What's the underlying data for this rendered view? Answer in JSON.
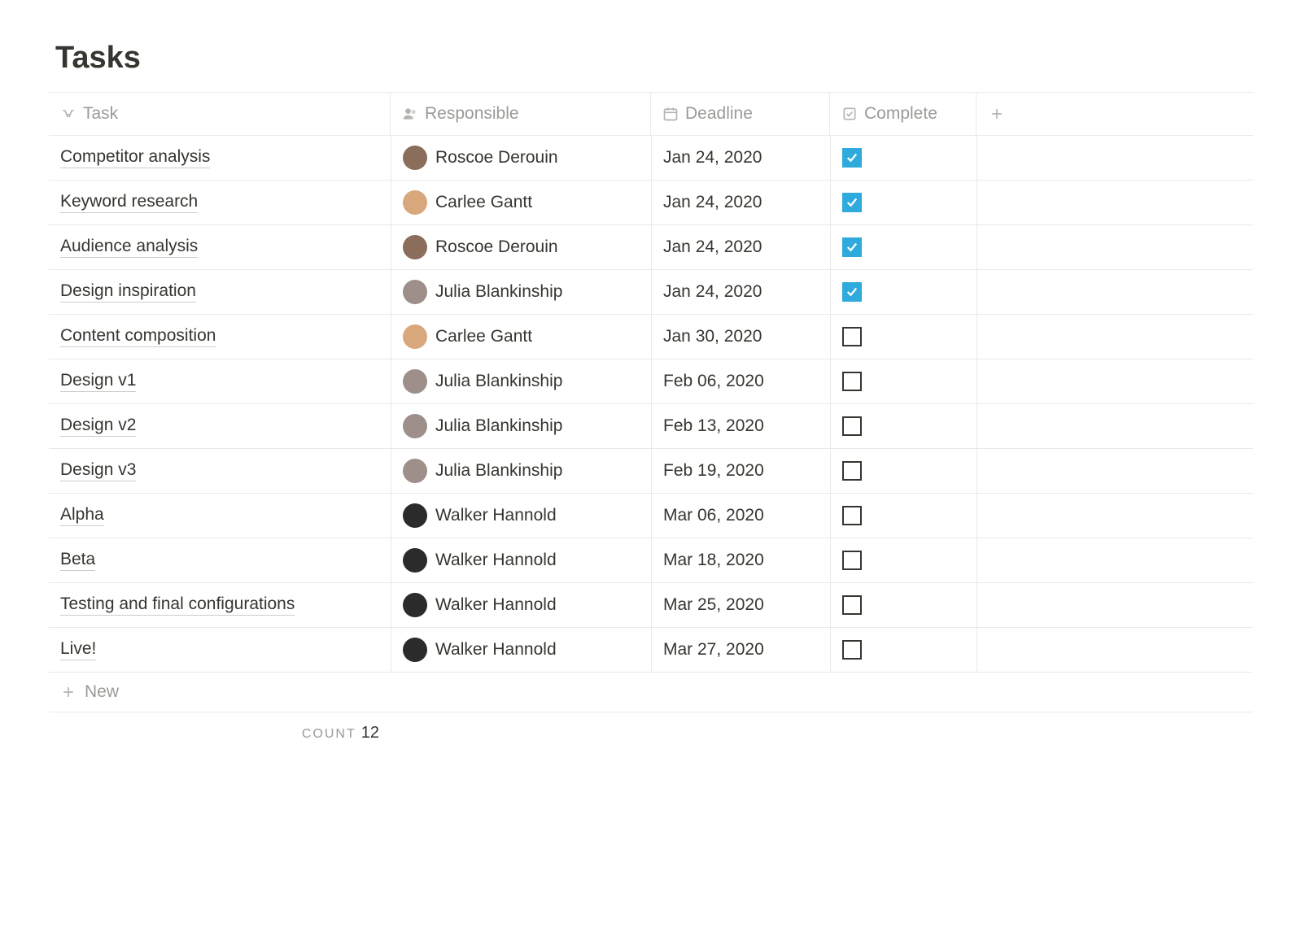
{
  "title": "Tasks",
  "columns": {
    "task": "Task",
    "responsible": "Responsible",
    "deadline": "Deadline",
    "complete": "Complete"
  },
  "people": {
    "roscoe": {
      "name": "Roscoe Derouin",
      "avatar_bg": "#8a6d5b"
    },
    "carlee": {
      "name": "Carlee Gantt",
      "avatar_bg": "#d9a77c"
    },
    "julia": {
      "name": "Julia Blankinship",
      "avatar_bg": "#9e8f8a"
    },
    "walker": {
      "name": "Walker Hannold",
      "avatar_bg": "#2b2b2b"
    }
  },
  "rows": [
    {
      "task": "Competitor analysis",
      "responsible": "roscoe",
      "deadline": "Jan 24, 2020",
      "complete": true
    },
    {
      "task": "Keyword research",
      "responsible": "carlee",
      "deadline": "Jan 24, 2020",
      "complete": true
    },
    {
      "task": "Audience analysis",
      "responsible": "roscoe",
      "deadline": "Jan 24, 2020",
      "complete": true
    },
    {
      "task": "Design inspiration",
      "responsible": "julia",
      "deadline": "Jan 24, 2020",
      "complete": true
    },
    {
      "task": "Content composition",
      "responsible": "carlee",
      "deadline": "Jan 30, 2020",
      "complete": false
    },
    {
      "task": "Design v1",
      "responsible": "julia",
      "deadline": "Feb 06, 2020",
      "complete": false
    },
    {
      "task": "Design v2",
      "responsible": "julia",
      "deadline": "Feb 13, 2020",
      "complete": false
    },
    {
      "task": "Design v3",
      "responsible": "julia",
      "deadline": "Feb 19, 2020",
      "complete": false
    },
    {
      "task": "Alpha",
      "responsible": "walker",
      "deadline": "Mar 06, 2020",
      "complete": false
    },
    {
      "task": "Beta",
      "responsible": "walker",
      "deadline": "Mar 18, 2020",
      "complete": false
    },
    {
      "task": "Testing and final configurations",
      "responsible": "walker",
      "deadline": "Mar 25, 2020",
      "complete": false
    },
    {
      "task": "Live!",
      "responsible": "walker",
      "deadline": "Mar 27, 2020",
      "complete": false
    }
  ],
  "new_row_label": "New",
  "count_label": "COUNT",
  "count_value": "12"
}
